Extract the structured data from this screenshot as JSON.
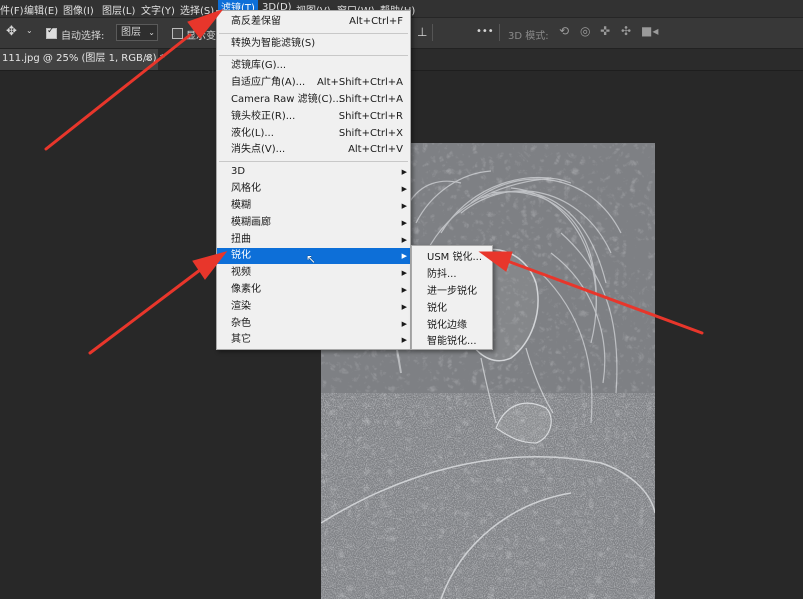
{
  "menubar": {
    "items": [
      "件(F)",
      "编辑(E)",
      "图像(I)",
      "图层(L)",
      "文字(Y)",
      "选择(S)",
      "滤镜(T)",
      "3D(D)",
      "视图(V)",
      "窗口(W)",
      "帮助(H)"
    ]
  },
  "options": {
    "auto_select_label": "自动选择:",
    "auto_select_value": "图层",
    "show_transform_label": "显示变",
    "mode_3d_label": "3D 模式:",
    "more_label": "•••"
  },
  "document_tab": {
    "title": "111.jpg @ 25% (图层 1, RGB/8) *",
    "close": "×"
  },
  "filter_menu": {
    "top": [
      {
        "label": "高反差保留",
        "shortcut": "Alt+Ctrl+F"
      }
    ],
    "smart": [
      {
        "label": "转换为智能滤镜(S)",
        "shortcut": ""
      }
    ],
    "gallery": [
      {
        "label": "滤镜库(G)...",
        "shortcut": ""
      },
      {
        "label": "自适应广角(A)...",
        "shortcut": "Alt+Shift+Ctrl+A"
      },
      {
        "label": "Camera Raw 滤镜(C)...",
        "shortcut": "Shift+Ctrl+A"
      },
      {
        "label": "镜头校正(R)...",
        "shortcut": "Shift+Ctrl+R"
      },
      {
        "label": "液化(L)...",
        "shortcut": "Shift+Ctrl+X"
      },
      {
        "label": "消失点(V)...",
        "shortcut": "Alt+Ctrl+V"
      }
    ],
    "groups": [
      "3D",
      "风格化",
      "模糊",
      "模糊画廊",
      "扭曲",
      "锐化",
      "视频",
      "像素化",
      "渲染",
      "杂色",
      "其它"
    ],
    "highlighted": "锐化"
  },
  "sharpen_submenu": {
    "items": [
      "USM 锐化...",
      "防抖...",
      "进一步锐化",
      "锐化",
      "锐化边缘",
      "智能锐化..."
    ]
  },
  "colors": {
    "highlight": "#0d6fd8",
    "annotation_arrow": "#e8362b"
  }
}
